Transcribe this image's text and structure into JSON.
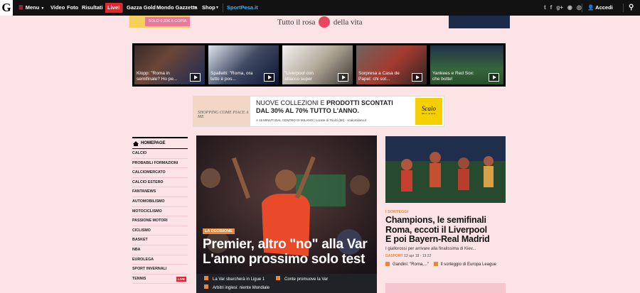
{
  "topbar": {
    "logo": "G",
    "menu_label": "Menu",
    "nav": [
      "Video",
      "Foto",
      "Risultati"
    ],
    "live_label": "Live!",
    "nav2": [
      "Gazza Gold",
      "Mondo Gazzetta",
      "Shop"
    ],
    "sportpesa": "SportPesa.it",
    "login_label": "Accedi"
  },
  "ads": {
    "top_left_text": "SOLO 0,33€ A COPIA",
    "tagline_left": "Tutto il rosa",
    "tagline_right": "della vita",
    "banner_line1_a": "NUOVE COLLEZIONI E ",
    "banner_line1_b": "PRODOTTI SCONTATI",
    "banner_line2": "DAL 30% AL 70% TUTTO L'ANNO.",
    "banner_line3": "A 15 MINUTI DAL CENTRO DI MILANO | Locate di Triulzi (MI) - scalomilano.it",
    "shopping_text": "SHOPPING COME PIACE A ME",
    "brand": "Scalo",
    "brand_sub": "MILANO"
  },
  "videos": [
    {
      "caption": "Klopp: \"Roma in semifinale? Ho pe..."
    },
    {
      "caption": "Spalletti: \"Roma, ora tutto è pos..."
    },
    {
      "caption": "\"Liverpool con attacco super"
    },
    {
      "caption": "Sorpresa a Casa de Papel: chi sot..."
    },
    {
      "caption": "Yankees e Red Sox: che botte!"
    }
  ],
  "sidebar": {
    "home_label": "HOMEPAGE",
    "items": [
      "CALCIO",
      "PROBABILI FORMAZIONI",
      "CALCIOMERCATO",
      "CALCIO ESTERO",
      "FANTANEWS",
      "AUTOMOBILISMO",
      "MOTOCICLISMO",
      "PASSIONE MOTORI",
      "CICLISMO",
      "BASKET",
      "NBA",
      "EUROLEGA",
      "SPORT INVERNALI",
      "TENNIS"
    ],
    "live_badge": "LIVE"
  },
  "main": {
    "label": "LA DECISIONE",
    "title_line1": "Premier, altro \"no\" alla Var",
    "title_line2": "L'anno prossimo solo test",
    "related": [
      "La Var sbarcherà in Ligue 1",
      "Conte promuove la Var",
      "Arbitri inglesi: niente Mondiale"
    ]
  },
  "right": {
    "label": "I SORTEGGI",
    "title_line1": "Champions, le semifinali",
    "title_line2": "Roma, eccoti il Liverpool",
    "title_line3": "E poi Bayern-Real Madrid",
    "desc": "I giallorossi per arrivare alla finalissima di Kiev...",
    "meta_source": "GASPORT",
    "meta_date": "13 apr 18 - 13:22",
    "links": [
      "Gandini: \"Roma,...\"",
      "Il sorteggio di Europa League"
    ]
  },
  "colors": {
    "accent": "#e8455e",
    "orange": "#e8873a",
    "background": "#fbe3e6"
  }
}
